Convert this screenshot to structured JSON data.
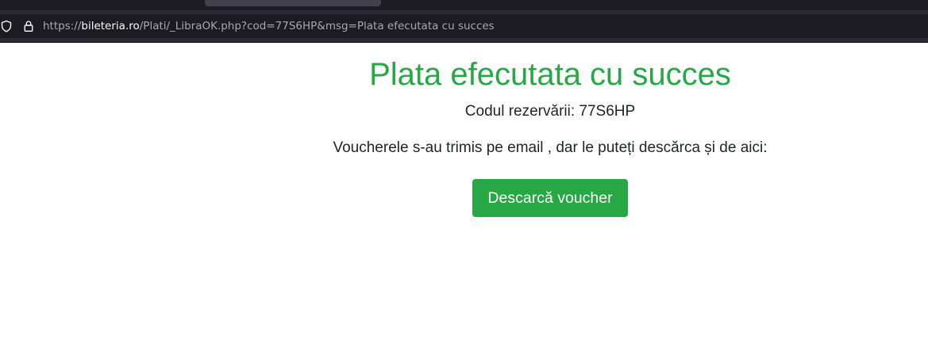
{
  "browser": {
    "url_prefix": "https://",
    "url_domain": "bileteria.ro",
    "url_path": "/Plati/_LibraOK.php?cod=77S6HP&msg=Plata efecutata cu succes",
    "icons": {
      "tracking_protection": "shield-icon",
      "connection": "lock-icon"
    }
  },
  "page": {
    "title": "Plata efecutata cu succes",
    "reservation_label": "Codul rezervării:",
    "reservation_code": "77S6HP",
    "voucher_message": "Voucherele s-au trimis pe email , dar le puteți descărca și de aici:",
    "download_button_label": "Descarcă voucher"
  },
  "colors": {
    "success_green": "#28a745",
    "text_dark": "#212529",
    "browser_chrome": "#1c1b22"
  }
}
